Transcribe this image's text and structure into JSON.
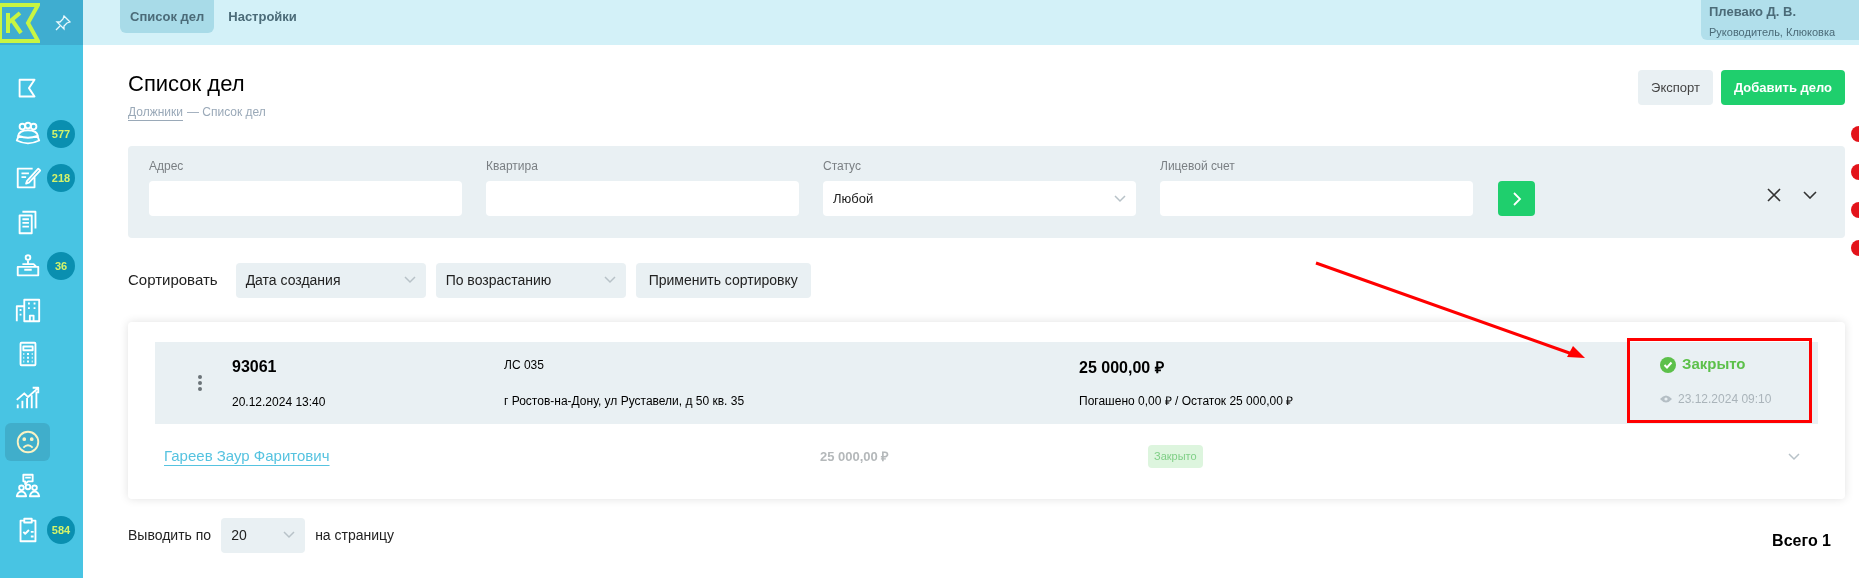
{
  "sidebar": {
    "items": [
      {
        "kind": "flag",
        "selected": false
      },
      {
        "kind": "people",
        "badge": "577",
        "selected": false
      },
      {
        "kind": "edit",
        "badge": "218",
        "selected": false
      },
      {
        "kind": "documents",
        "selected": false
      },
      {
        "kind": "desk",
        "badge": "36",
        "selected": false
      },
      {
        "kind": "building",
        "selected": false
      },
      {
        "kind": "calculator",
        "selected": false
      },
      {
        "kind": "chart",
        "selected": false
      },
      {
        "kind": "sad",
        "selected": true
      },
      {
        "kind": "meeting",
        "selected": false
      },
      {
        "kind": "clipboard",
        "badge": "584",
        "selected": false
      }
    ]
  },
  "top_tabs": [
    {
      "label": "Список дел",
      "selected": true
    },
    {
      "label": "Настройки",
      "selected": false
    }
  ],
  "user": {
    "name": "Плевако Д. В.",
    "role": "Руководитель, Клюковка"
  },
  "page": {
    "title": "Список дел",
    "breadcrumb": {
      "link": "Должники",
      "current": "— Список дел"
    },
    "buttons": [
      {
        "label": "Экспорт",
        "kind": "secondary"
      },
      {
        "label": "Добавить дело",
        "kind": "primary"
      }
    ]
  },
  "filters": [
    {
      "label": "Адрес",
      "kind": "input"
    },
    {
      "label": "Квартира",
      "kind": "input"
    },
    {
      "label": "Статус",
      "kind": "select",
      "value": "Любой"
    },
    {
      "label": "Лицевой счет",
      "kind": "input"
    }
  ],
  "sort": {
    "label": "Сортировать",
    "selects": [
      "Дата создания",
      "По возрастанию"
    ],
    "apply": "Применить сортировку"
  },
  "cases": [
    {
      "number": "93061",
      "created": "20.12.2024 13:40",
      "account": "ЛС 035",
      "address": "г Ростов-на-Дону, ул Руставели, д 50 кв. 35",
      "amount": "25 000,00 ₽",
      "paid": "Погашено 0,00 ₽ / Остаток 25 000,00 ₽",
      "status": "Закрыто",
      "status_date": "23.12.2024 09:10",
      "debtor": "Гареев Заур Фаритович",
      "debtor_amount": "25 000,00 ₽",
      "debtor_status": "Закрыто"
    }
  ],
  "footer": {
    "label": "Выводить по",
    "per_page": "20",
    "suffix": "на страницу",
    "total": "Всего 1"
  }
}
